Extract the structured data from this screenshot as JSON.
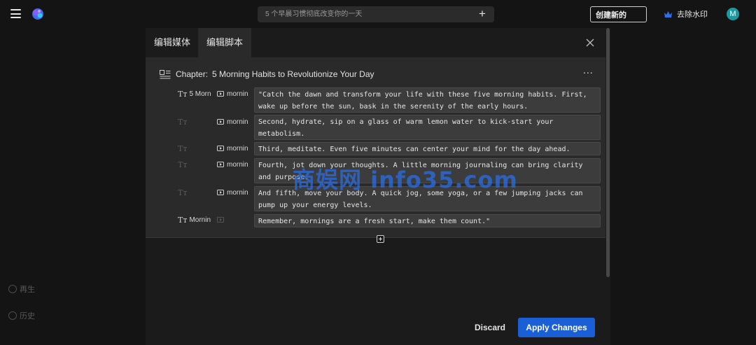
{
  "topbar": {
    "prompt_placeholder": "5 个早晨习惯彻底改变你的一天",
    "create_label": "创建新的",
    "remove_watermark_label": "去除水印",
    "avatar_initial": "M"
  },
  "sidebar": {
    "regen_label": "再生",
    "history_label": "历史"
  },
  "modal": {
    "tabs": [
      {
        "label": "编辑媒体"
      },
      {
        "label": "编辑脚本"
      }
    ],
    "chapter": {
      "label": "Chapter:",
      "title": "5 Morning Habits to Revolutionize Your Day"
    },
    "rows": [
      {
        "text_label": "5 Morn",
        "media_label": "mornin",
        "script": "\"Catch the dawn and transform your life with these five morning habits. First, wake up before the sun, bask in the serenity of the early hours."
      },
      {
        "text_label": "",
        "media_label": "mornin",
        "script": "Second, hydrate, sip on a glass of warm lemon water to kick-start your metabolism."
      },
      {
        "text_label": "",
        "media_label": "mornin",
        "script": "Third, meditate. Even five minutes can center your mind for the day ahead."
      },
      {
        "text_label": "",
        "media_label": "mornin",
        "script": "Fourth, jot down your thoughts. A little morning journaling can bring clarity and purpose."
      },
      {
        "text_label": "",
        "media_label": "mornin",
        "script": "And fifth, move your body. A quick jog, some yoga, or a few jumping jacks can pump up your energy levels."
      },
      {
        "text_label": "Mornin",
        "media_label": "",
        "script": "Remember, mornings are a fresh start, make them count.\""
      }
    ],
    "discard_label": "Discard",
    "apply_label": "Apply Changes"
  },
  "watermark_text": "商娱网 info35.com",
  "colors": {
    "background": "#141414",
    "panel": "#2a2a2a",
    "accent": "#1a5fd6",
    "avatar": "#1a9aa0"
  }
}
